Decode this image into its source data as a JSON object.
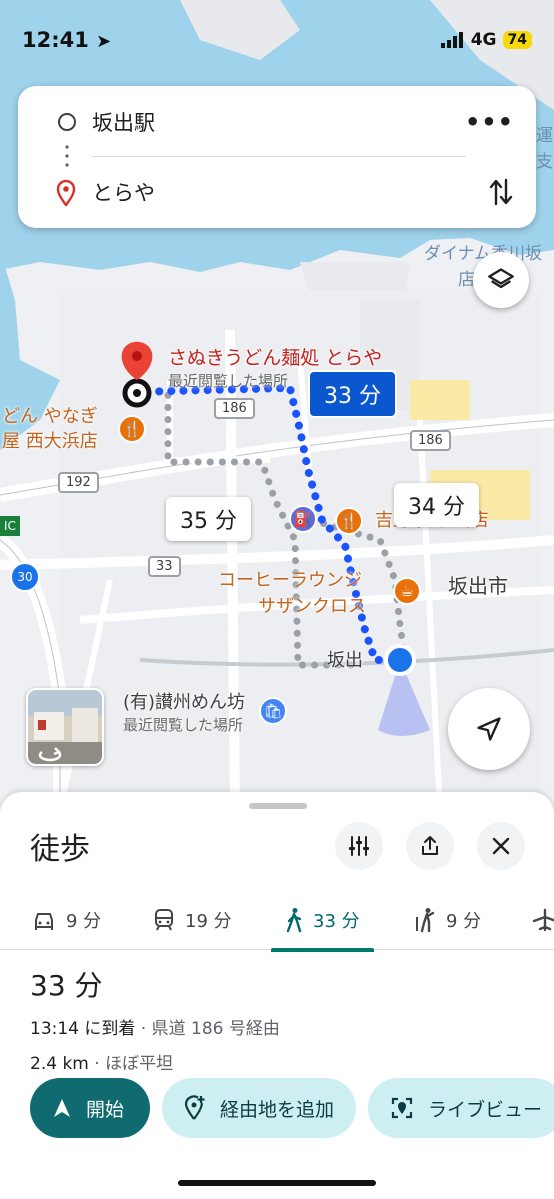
{
  "status_bar": {
    "time": "12:41",
    "network": "4G",
    "battery": "74"
  },
  "route": {
    "origin": "坂出駅",
    "destination": "とらや"
  },
  "map": {
    "dest_name": "さぬきうどん麺処 とらや",
    "dest_sub": "最近閲覧した場所",
    "poi_yanagi_1": "どん やなぎ",
    "poi_yanagi_2": "屋 西大浜店",
    "poi_yoshiya": "吉野家 坂出店",
    "coffee_1": "コーヒーラウンジ",
    "coffee_2": "サザンクロス",
    "city": "坂出市",
    "station": "坂出",
    "menbo": "(有)讃州めん坊",
    "menbo_sub": "最近閲覧した場所",
    "dynam_1": "ダイナム香川坂",
    "dynam_2": "店",
    "unga": "運",
    "shi": "支",
    "ic": "IC",
    "route_186a": "186",
    "route_186b": "186",
    "route_192": "192",
    "route_33": "33",
    "route_30": "30",
    "bubble_main": "33 分",
    "bubble_alt1": "35 分",
    "bubble_alt2": "34 分"
  },
  "sheet": {
    "title": "徒歩",
    "modes": [
      {
        "label": "9 分",
        "icon": "car-icon"
      },
      {
        "label": "19 分",
        "icon": "train-icon"
      },
      {
        "label": "33 分",
        "icon": "walk-icon"
      },
      {
        "label": "9 分",
        "icon": "rideshare-icon"
      }
    ],
    "duration": "33 分",
    "arrival_bold": "13:14 に到着",
    "arrival_via": " · 県道 186 号経由",
    "distance_bold": "2.4 km",
    "distance_note": " · ほぼ平坦",
    "start_label": "開始",
    "add_stop_label": "経由地を追加",
    "liveview_label": "ライブビュー"
  },
  "colors": {
    "accent": "#0f6b70",
    "route_blue": "#1a53ff",
    "water": "#9fd3ec"
  }
}
